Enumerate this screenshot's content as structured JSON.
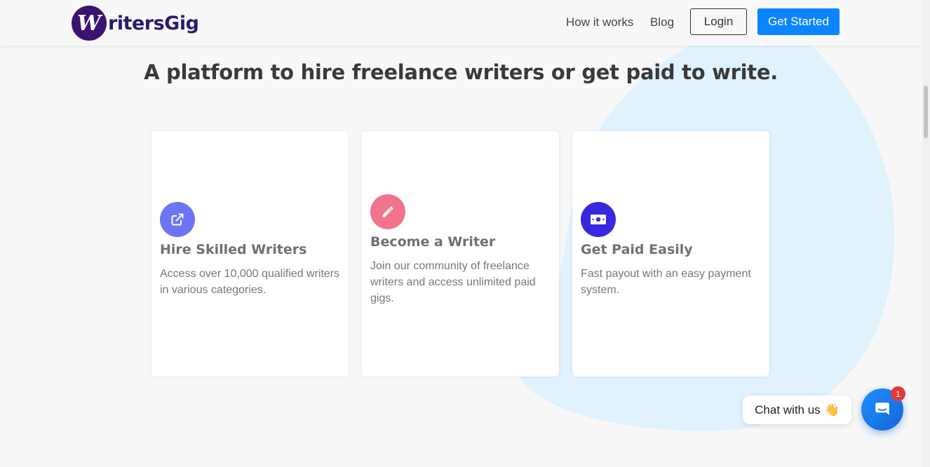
{
  "brand": {
    "mark": "W",
    "name": "ritersGig"
  },
  "nav": {
    "how_it_works": "How it works",
    "blog": "Blog",
    "login": "Login",
    "get_started": "Get Started"
  },
  "headline": "A platform to hire freelance writers or get paid to write.",
  "cards": [
    {
      "icon": "external-link-icon",
      "title": "Hire Skilled Writers",
      "desc": "Access over 10,000 qualified writers in various categories.",
      "color": "#6d75f4"
    },
    {
      "icon": "pencil-icon",
      "title": "Become a Writer",
      "desc": "Join our community of freelance writers and access unlimited paid gigs.",
      "color": "#f2748a"
    },
    {
      "icon": "money-bill-icon",
      "title": "Get Paid Easily",
      "desc": "Fast payout with an easy payment system.",
      "color": "#3928e0"
    }
  ],
  "chat": {
    "label": "Chat with us",
    "wave": "👋",
    "badge": "1"
  },
  "colors": {
    "primary": "#0b84ff",
    "brand": "#3b1270",
    "blob": "#dff2fd"
  }
}
